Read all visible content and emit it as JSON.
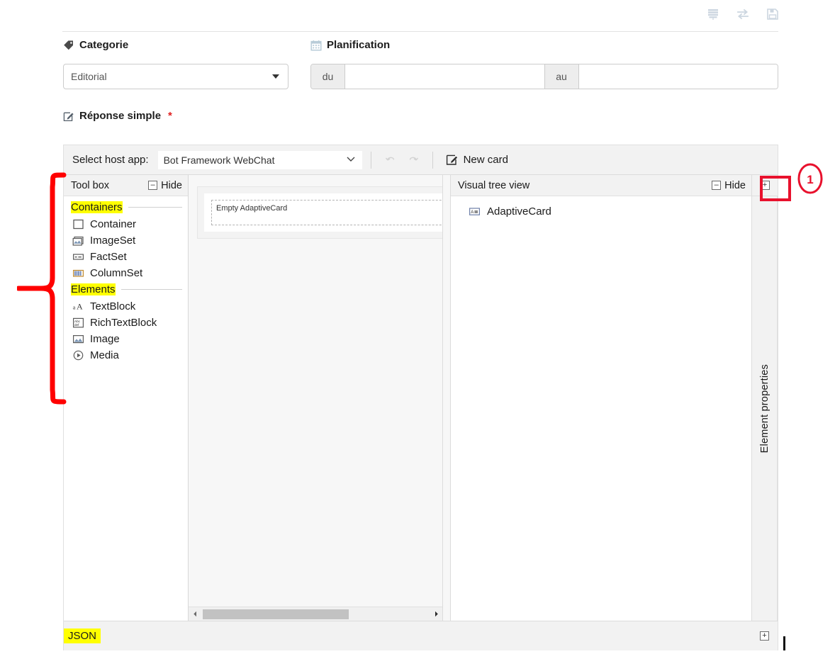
{
  "topbar": {
    "icons": [
      {
        "name": "layers-icon",
        "title": "Layers"
      },
      {
        "name": "swap-arrows-icon",
        "title": "Swap"
      },
      {
        "name": "save-floppy-icon",
        "title": "Save"
      }
    ]
  },
  "form": {
    "categorie": {
      "label": "Categorie",
      "icon": "tag-icon",
      "selected": "Editorial"
    },
    "planification": {
      "label": "Planification",
      "icon": "calendar-icon",
      "from_addon": "du",
      "to_addon": "au",
      "from_value": "",
      "to_value": "",
      "from_placeholder": "",
      "to_placeholder": ""
    },
    "reponse": {
      "label": "Réponse simple",
      "icon": "edit-square-icon",
      "required_marker": "*"
    }
  },
  "designer": {
    "toolbar": {
      "host_label": "Select host app:",
      "host_value": "Bot Framework WebChat",
      "undo_label": "Undo",
      "redo_label": "Redo",
      "new_card_label": "New card"
    },
    "toolbox": {
      "title": "Tool box",
      "hide_label": "Hide",
      "groups": [
        {
          "name": "Containers",
          "highlighted": true,
          "items": [
            {
              "label": "Container",
              "icon": "container-square-icon"
            },
            {
              "label": "ImageSet",
              "icon": "imageset-icon"
            },
            {
              "label": "FactSet",
              "icon": "factset-icon"
            },
            {
              "label": "ColumnSet",
              "icon": "columnset-icon"
            }
          ]
        },
        {
          "name": "Elements",
          "highlighted": true,
          "items": [
            {
              "label": "TextBlock",
              "icon": "textblock-icon"
            },
            {
              "label": "RichTextBlock",
              "icon": "richtextblock-icon"
            },
            {
              "label": "Image",
              "icon": "image-icon"
            },
            {
              "label": "Media",
              "icon": "media-play-icon"
            }
          ]
        }
      ]
    },
    "canvas": {
      "card_placeholder": "Empty AdaptiveCard",
      "scrollbar_left_arrow": "◀",
      "scrollbar_right_arrow": "▶"
    },
    "tree": {
      "title": "Visual tree view",
      "hide_label": "Hide",
      "nodes": [
        {
          "label": "AdaptiveCard",
          "icon": "adaptivecard-icon"
        }
      ]
    },
    "properties": {
      "title": "Element properties",
      "expand_symbol": "+"
    },
    "json_bar": {
      "label": "JSON",
      "highlighted": true,
      "expand_symbol": "+"
    }
  },
  "annotations": {
    "callout_number": "1",
    "callout_color": "#e8112d",
    "highlight_color": "#ffff00",
    "bracket_label": ""
  }
}
